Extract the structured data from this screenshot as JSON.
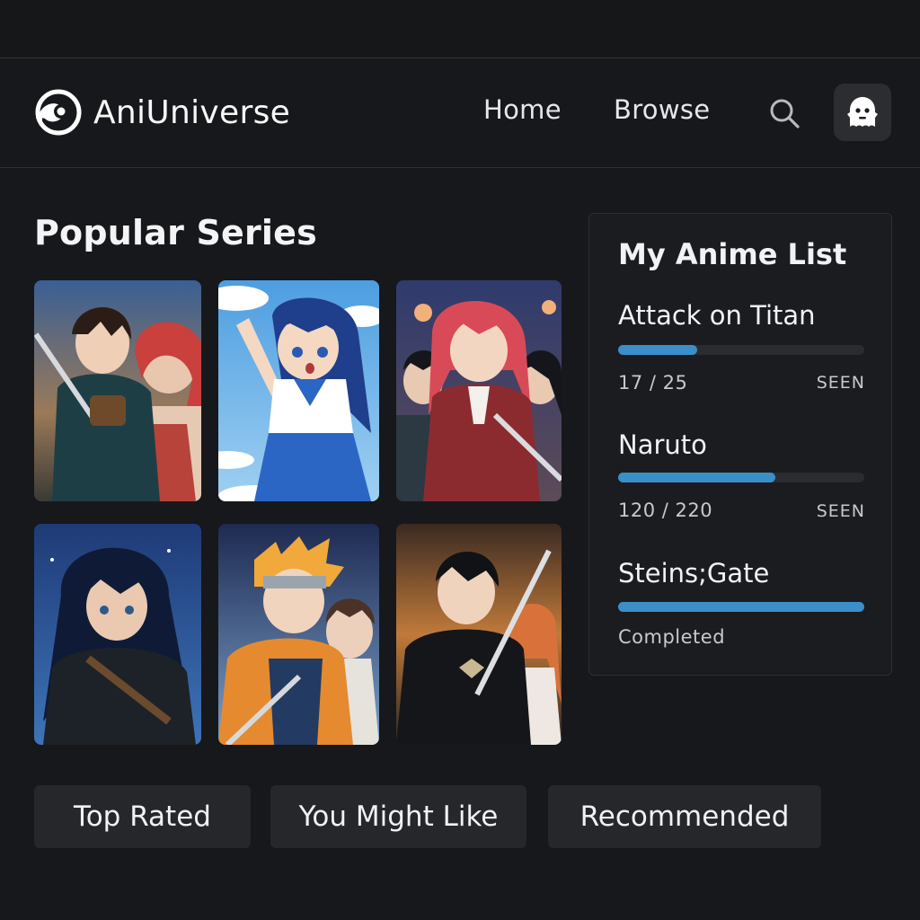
{
  "app": {
    "name": "AniUniverse"
  },
  "nav": {
    "links": [
      "Home",
      "Browse"
    ]
  },
  "colors": {
    "background": "#17181b",
    "accent": "#3a8fc8",
    "panel": "#1b1c20",
    "button": "#26272b"
  },
  "icons": {
    "logo": "eye-swirl-logo-icon",
    "search": "search-icon",
    "avatar": "ghost-avatar-icon"
  },
  "popular": {
    "title": "Popular Series",
    "cards": [
      {
        "art": "swordsman and red-haired girl artwork"
      },
      {
        "art": "blue-haired girl in sailor uniform artwork"
      },
      {
        "art": "red-haired swordswoman artwork"
      },
      {
        "art": "long dark-haired warrior artwork"
      },
      {
        "art": "blonde ninja with headband artwork"
      },
      {
        "art": "black swordsman and orange-haired girl artwork"
      }
    ]
  },
  "anime_list": {
    "title": "My Anime List",
    "entries": [
      {
        "title": "Attack on Titan",
        "progress_text": "17 / 25",
        "status": "SEEN",
        "fraction": 0.32
      },
      {
        "title": "Naruto",
        "progress_text": "120 / 220",
        "status": "SEEN",
        "fraction": 0.64
      },
      {
        "title": "Steins;Gate",
        "progress_text": "Completed",
        "status": "",
        "fraction": 1.0
      }
    ]
  },
  "categories": [
    "Top Rated",
    "You Might Like",
    "Recommended"
  ]
}
